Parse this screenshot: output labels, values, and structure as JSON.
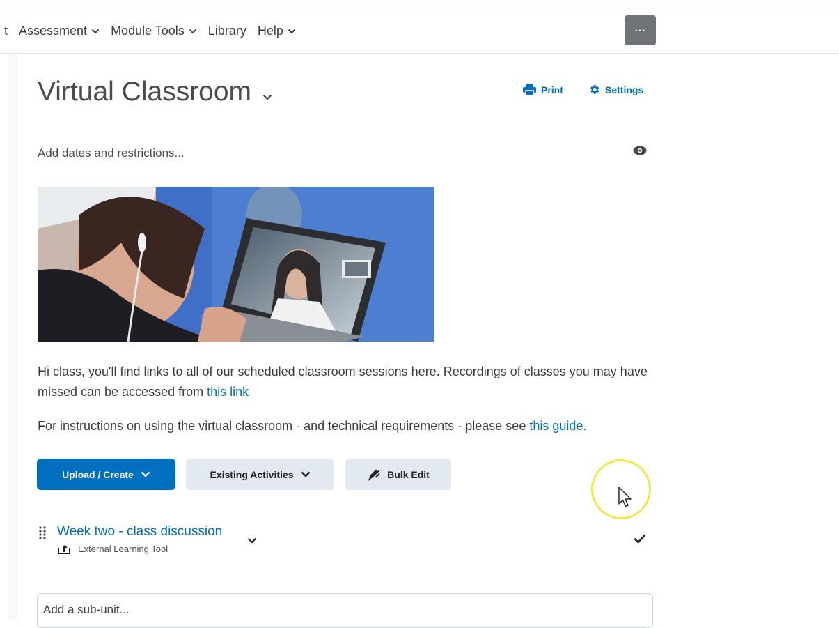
{
  "nav": {
    "items": [
      {
        "label": "t",
        "has_menu": false
      },
      {
        "label": "Assessment",
        "has_menu": true
      },
      {
        "label": "Module Tools",
        "has_menu": true
      },
      {
        "label": "Library",
        "has_menu": false
      },
      {
        "label": "Help",
        "has_menu": true
      }
    ],
    "more_label": "..."
  },
  "module": {
    "title": "Virtual Classroom",
    "print_label": "Print",
    "settings_label": "Settings",
    "dates_label": "Add dates and restrictions..."
  },
  "content": {
    "para1_text": "Hi class, you'll find links to all of our scheduled classroom sessions here. Recordings of classes you may have missed can be accessed from ",
    "para1_link": "this link",
    "para2_text": "For instructions on using the virtual classroom - and technical requirements - please see ",
    "para2_link": "this guide."
  },
  "actions": {
    "upload_label": "Upload / Create",
    "existing_label": "Existing Activities",
    "bulk_label": "Bulk Edit"
  },
  "topic": {
    "title": "Week two - class discussion",
    "type": "External Learning Tool"
  },
  "subunit": {
    "placeholder": "Add a sub-unit..."
  },
  "colors": {
    "accent": "#006fbf",
    "secondary_button": "#e3e9f1",
    "cursor_highlight": "#f0ea48"
  }
}
